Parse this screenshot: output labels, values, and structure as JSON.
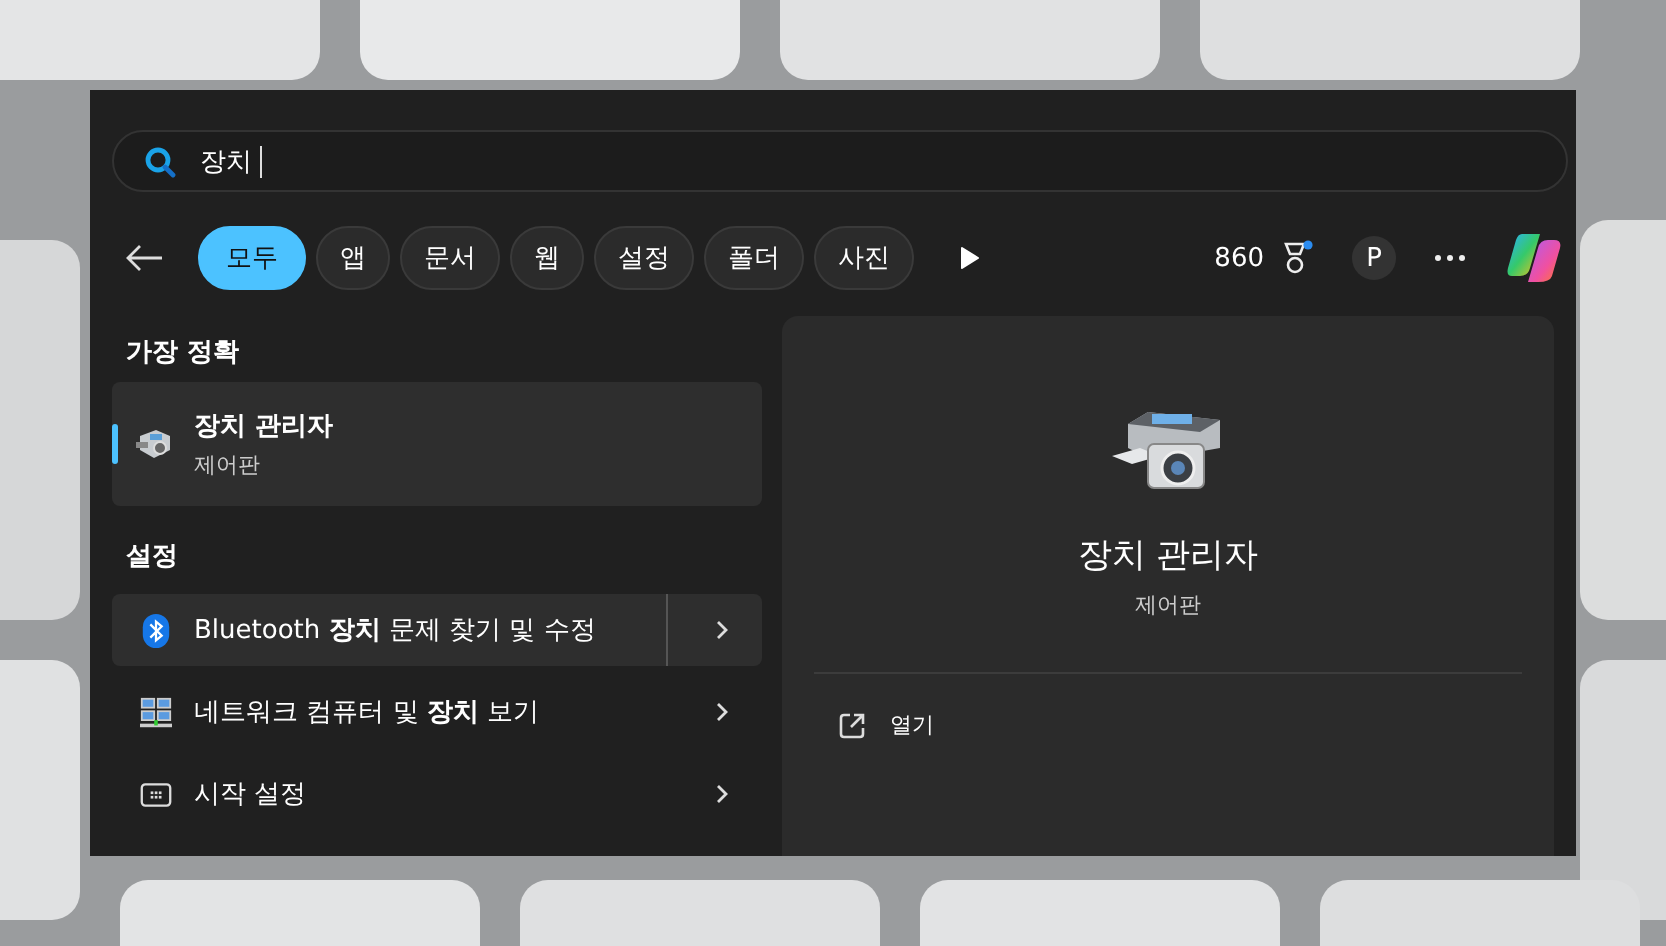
{
  "search": {
    "value": "장치"
  },
  "filters": [
    {
      "label": "모두",
      "selected": true
    },
    {
      "label": "앱",
      "selected": false
    },
    {
      "label": "문서",
      "selected": false
    },
    {
      "label": "웹",
      "selected": false
    },
    {
      "label": "설정",
      "selected": false
    },
    {
      "label": "폴더",
      "selected": false
    },
    {
      "label": "사진",
      "selected": false
    }
  ],
  "rewards": {
    "points": "860",
    "notification": true
  },
  "avatar": "P",
  "best_match": {
    "heading": "가장 정확",
    "title": "장치 관리자",
    "subtitle": "제어판",
    "selected": true
  },
  "settings": {
    "heading": "설정",
    "items": [
      {
        "kind": "bluetooth",
        "label": "Bluetooth **장치** 문제 찾기 및 수정",
        "highlighted": true
      },
      {
        "kind": "network",
        "label": "네트워크 컴퓨터 및 **장치** 보기",
        "highlighted": false
      },
      {
        "kind": "start",
        "label": "시작 설정",
        "highlighted": false
      }
    ]
  },
  "preview": {
    "title": "장치 관리자",
    "subtitle": "제어판",
    "actions": [
      {
        "label": "열기"
      }
    ]
  }
}
